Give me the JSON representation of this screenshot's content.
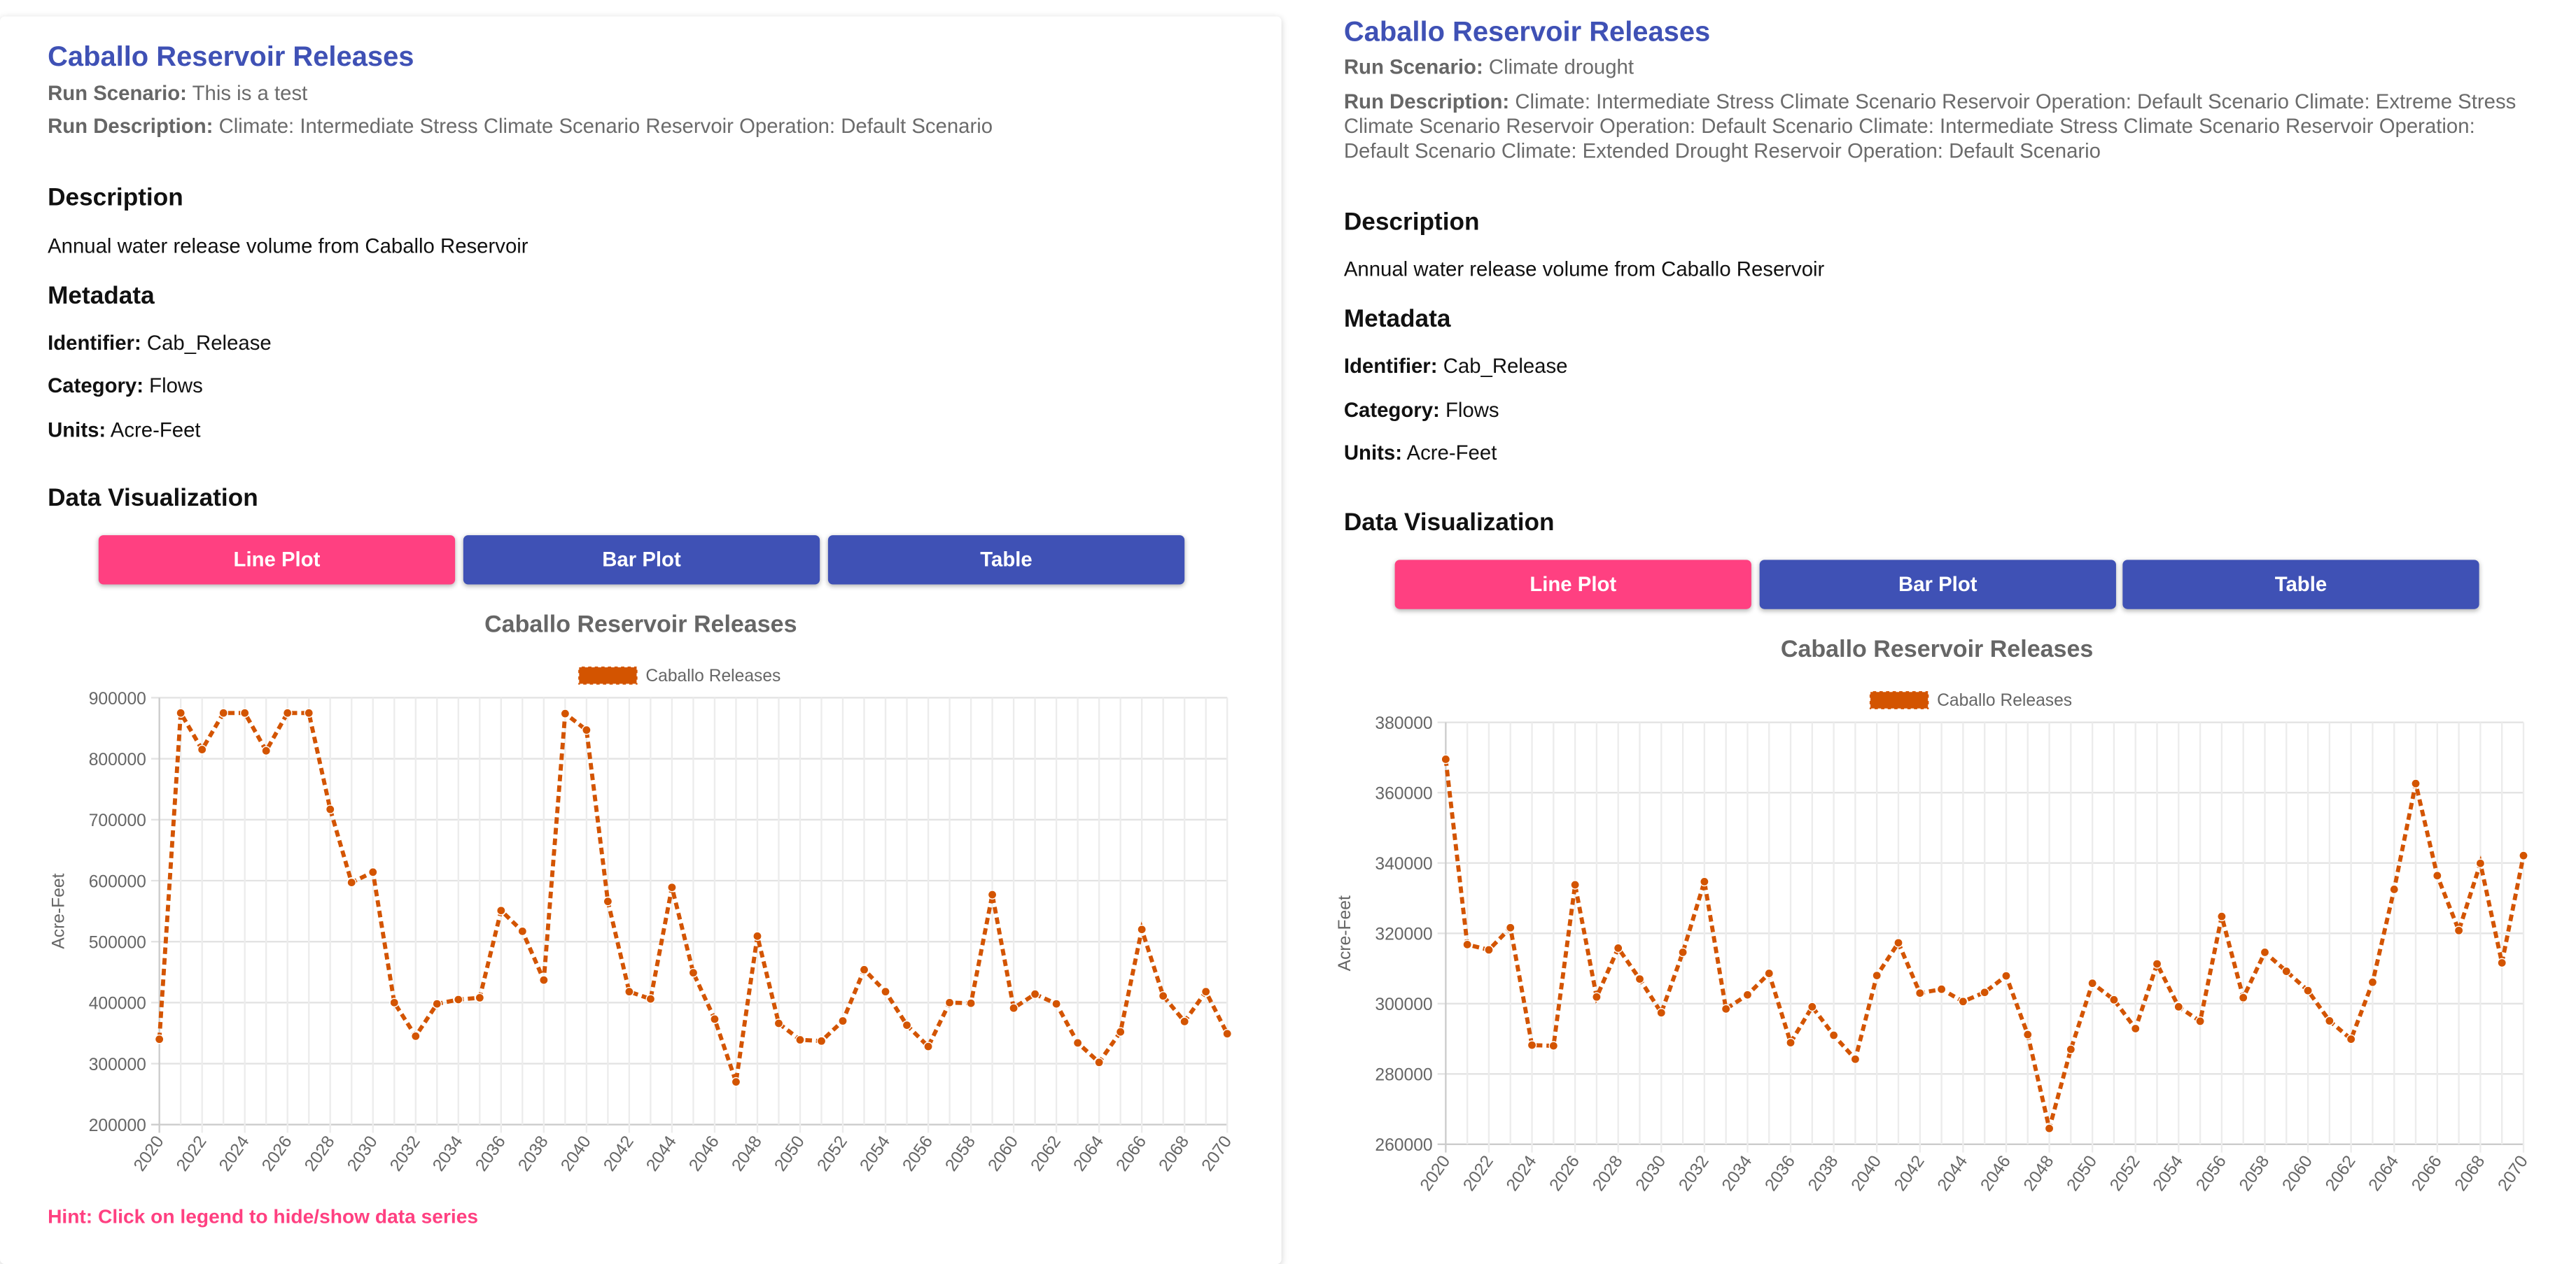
{
  "colors": {
    "accent": "#3f51b5",
    "active_button": "#ff4081",
    "series": "#d35400"
  },
  "panels": [
    {
      "title": "Caballo Reservoir Releases",
      "run_scenario_label": "Run Scenario:",
      "run_scenario": "This is a test",
      "run_description_label": "Run Description:",
      "run_description": "Climate: Intermediate Stress Climate Scenario Reservoir Operation: Default Scenario",
      "description_heading": "Description",
      "description": "Annual water release volume from Caballo Reservoir",
      "metadata_heading": "Metadata",
      "identifier_label": "Identifier:",
      "identifier": "Cab_Release",
      "category_label": "Category:",
      "category": "Flows",
      "units_label": "Units:",
      "units": "Acre-Feet",
      "viz_heading": "Data Visualization",
      "buttons": {
        "line": "Line Plot",
        "bar": "Bar Plot",
        "table": "Table"
      },
      "active_button": "Line Plot",
      "hint": "Hint: Click on legend to hide/show data series"
    },
    {
      "title": "Caballo Reservoir Releases",
      "run_scenario_label": "Run Scenario:",
      "run_scenario": "Climate drought",
      "run_description_label": "Run Description:",
      "run_description": "Climate: Intermediate Stress Climate Scenario Reservoir Operation: Default Scenario Climate: Extreme Stress Climate Scenario Reservoir Operation: Default Scenario Climate: Intermediate Stress Climate Scenario Reservoir Operation: Default Scenario Climate: Extended Drought Reservoir Operation: Default Scenario",
      "description_heading": "Description",
      "description": "Annual water release volume from Caballo Reservoir",
      "metadata_heading": "Metadata",
      "identifier_label": "Identifier:",
      "identifier": "Cab_Release",
      "category_label": "Category:",
      "category": "Flows",
      "units_label": "Units:",
      "units": "Acre-Feet",
      "viz_heading": "Data Visualization",
      "buttons": {
        "line": "Line Plot",
        "bar": "Bar Plot",
        "table": "Table"
      },
      "active_button": "Line Plot"
    }
  ],
  "chart_data": [
    {
      "type": "line",
      "title": "Caballo Reservoir Releases",
      "ylabel": "Acre-Feet",
      "xlabel": "",
      "legend": "top",
      "grid": true,
      "line_style": "dashed",
      "ylim": [
        200000,
        900000
      ],
      "yticks": [
        200000,
        300000,
        400000,
        500000,
        600000,
        700000,
        800000,
        900000
      ],
      "x": [
        2020,
        2021,
        2022,
        2023,
        2024,
        2025,
        2026,
        2027,
        2028,
        2029,
        2030,
        2031,
        2032,
        2033,
        2034,
        2035,
        2036,
        2037,
        2038,
        2039,
        2040,
        2041,
        2042,
        2043,
        2044,
        2045,
        2046,
        2047,
        2048,
        2049,
        2050,
        2051,
        2052,
        2053,
        2054,
        2055,
        2056,
        2057,
        2058,
        2059,
        2060,
        2061,
        2062,
        2063,
        2064,
        2065,
        2066,
        2067,
        2068,
        2069,
        2070
      ],
      "series": [
        {
          "name": "Caballo Releases",
          "values": [
            340000,
            875000,
            815000,
            875000,
            875000,
            813000,
            875000,
            875000,
            717000,
            597000,
            614000,
            400000,
            345000,
            398000,
            405000,
            408000,
            551000,
            517000,
            437000,
            874000,
            847000,
            566000,
            418000,
            406000,
            589000,
            449000,
            373000,
            270000,
            509000,
            366000,
            339000,
            337000,
            370000,
            454000,
            418000,
            363000,
            328000,
            400000,
            399000,
            577000,
            391000,
            414000,
            398000,
            334000,
            302000,
            352000,
            520000,
            411000,
            369000,
            418000,
            349000
          ]
        }
      ]
    },
    {
      "type": "line",
      "title": "Caballo Reservoir Releases",
      "ylabel": "Acre-Feet",
      "xlabel": "",
      "legend": "top",
      "grid": true,
      "line_style": "dashed",
      "ylim": [
        260000,
        380000
      ],
      "yticks": [
        260000,
        280000,
        300000,
        320000,
        340000,
        360000,
        380000
      ],
      "x": [
        2020,
        2021,
        2022,
        2023,
        2024,
        2025,
        2026,
        2027,
        2028,
        2029,
        2030,
        2031,
        2032,
        2033,
        2034,
        2035,
        2036,
        2037,
        2038,
        2039,
        2040,
        2041,
        2042,
        2043,
        2044,
        2045,
        2046,
        2047,
        2048,
        2049,
        2050,
        2051,
        2052,
        2053,
        2054,
        2055,
        2056,
        2057,
        2058,
        2059,
        2060,
        2061,
        2062,
        2063,
        2064,
        2065,
        2066,
        2067,
        2068,
        2069,
        2070
      ],
      "series": [
        {
          "name": "Caballo Releases",
          "values": [
            369500,
            316800,
            315300,
            321600,
            288200,
            288000,
            333800,
            301900,
            315800,
            307000,
            297400,
            314600,
            334700,
            298500,
            302500,
            308600,
            288900,
            299100,
            291000,
            284200,
            308000,
            317300,
            303000,
            304100,
            300600,
            303200,
            307900,
            291200,
            264500,
            287000,
            305800,
            301100,
            292900,
            311300,
            299100,
            295000,
            324800,
            301700,
            314600,
            309200,
            303700,
            295100,
            289900,
            306100,
            332500,
            362600,
            336400,
            320800,
            339900,
            311600,
            342100
          ]
        }
      ]
    }
  ]
}
